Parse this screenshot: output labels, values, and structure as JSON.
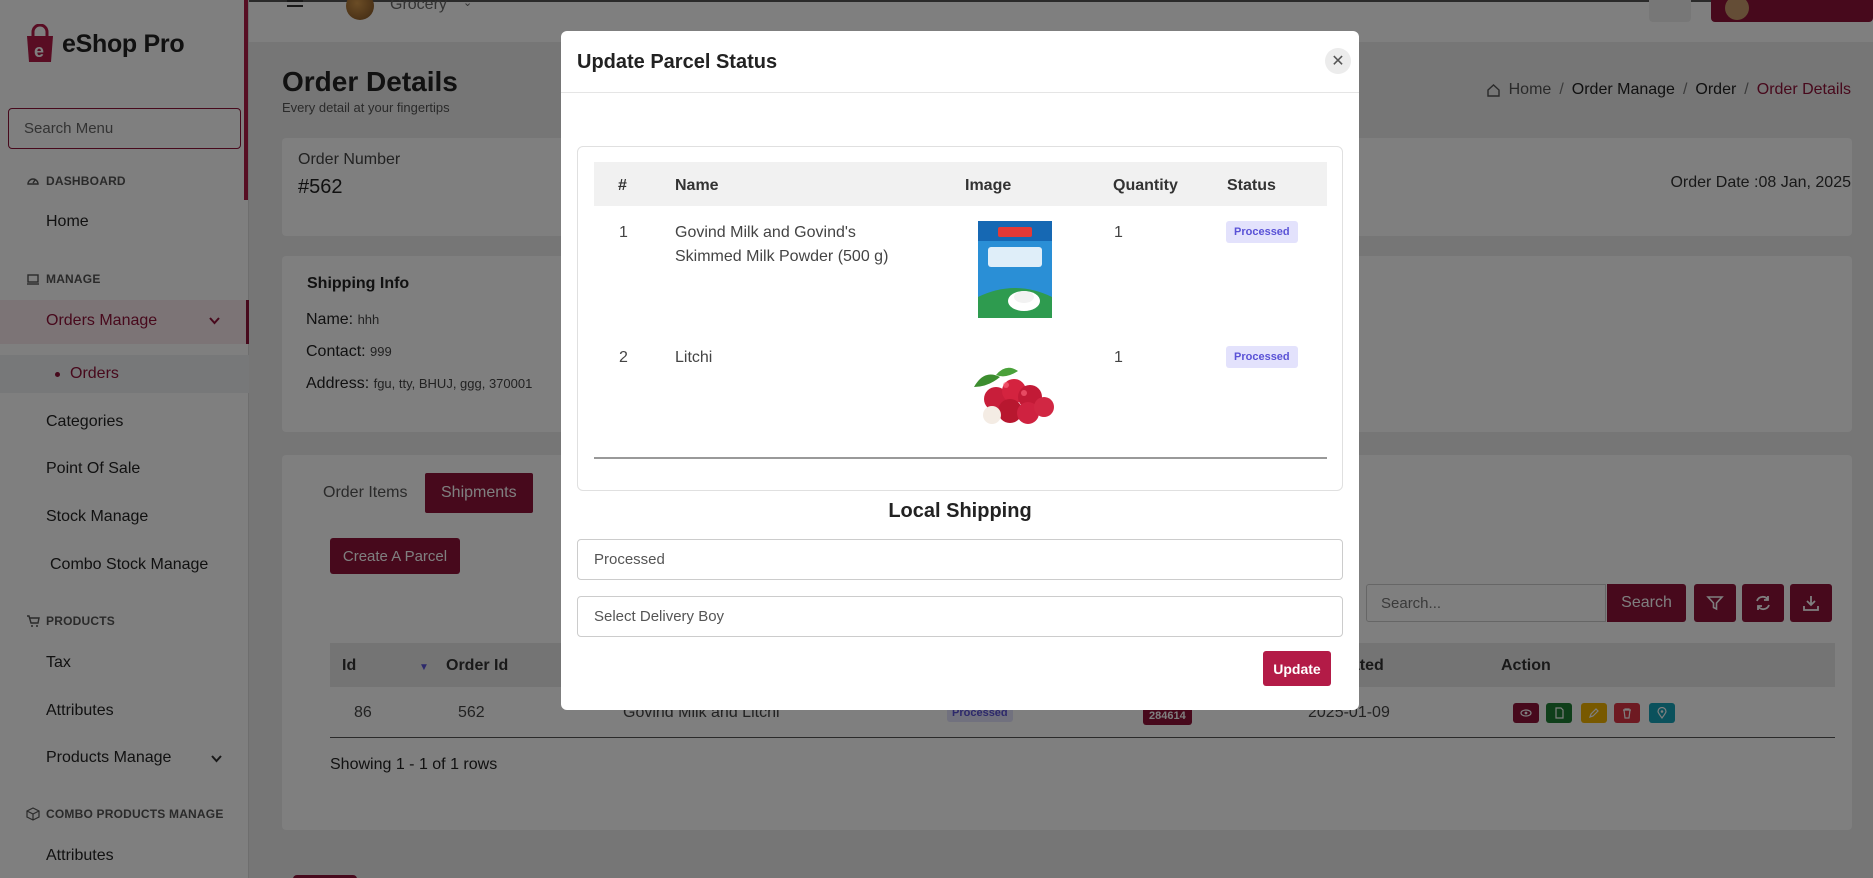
{
  "brand": {
    "name": "eShop Pro"
  },
  "sidebar": {
    "search_placeholder": "Search Menu",
    "sections": {
      "dashboard": "DASHBOARD",
      "manage": "MANAGE",
      "products": "PRODUCTS",
      "combo": "COMBO PRODUCTS MANAGE"
    },
    "items": {
      "home": "Home",
      "orders_manage": "Orders Manage",
      "orders": "Orders",
      "categories": "Categories",
      "pos": "Point Of Sale",
      "stock": "Stock Manage",
      "combo_stock": "Combo Stock Manage",
      "tax": "Tax",
      "attributes": "Attributes",
      "products_manage": "Products Manage",
      "combo_attributes": "Attributes"
    }
  },
  "topbar": {
    "store_name": "Grocery"
  },
  "page": {
    "title": "Order Details",
    "subtitle": "Every detail at your fingertips",
    "breadcrumb": [
      "Home",
      "Order Manage",
      "Order",
      "Order Details"
    ]
  },
  "order": {
    "number_label": "Order Number",
    "number": "#562",
    "date_label": "Order Date :",
    "date": "08 Jan, 2025"
  },
  "shipping": {
    "title": "Shipping Info",
    "name_label": "Name:",
    "name": "hhh",
    "contact_label": "Contact:",
    "contact": "999",
    "address_label": "Address:",
    "address": "fgu, tty, BHUJ, ggg, 370001"
  },
  "tabs": {
    "order_items": "Order Items",
    "shipments": "Shipments"
  },
  "shipments": {
    "create_button": "Create A Parcel",
    "search_placeholder": "Search...",
    "search_button": "Search",
    "columns": {
      "id": "Id",
      "order_id": "Order Id",
      "created": "eated",
      "action": "Action"
    },
    "row": {
      "id": "86",
      "order_id": "562",
      "name": "Govind Milk and Litchi",
      "status": "Processed",
      "tracking": "284614",
      "created": "2025-01-09"
    },
    "showing": "Showing 1 - 1 of 1 rows"
  },
  "modal": {
    "title": "Update Parcel Status",
    "columns": {
      "num": "#",
      "name": "Name",
      "image": "Image",
      "quantity": "Quantity",
      "status": "Status"
    },
    "items": [
      {
        "num": "1",
        "name": "Govind Milk and Govind's Skimmed Milk Powder (500 g)",
        "quantity": "1",
        "status": "Processed",
        "image": "milk-powder-pack-icon"
      },
      {
        "num": "2",
        "name": "Litchi",
        "quantity": "1",
        "status": "Processed",
        "image": "litchi-fruit-icon"
      }
    ],
    "local_shipping": "Local Shipping",
    "status_value": "Processed",
    "delivery_placeholder": "Select Delivery Boy",
    "update_button": "Update"
  },
  "colors": {
    "accent": "#8f1239",
    "pill_bg": "#e3e2fc",
    "pill_text": "#5a52d6"
  }
}
